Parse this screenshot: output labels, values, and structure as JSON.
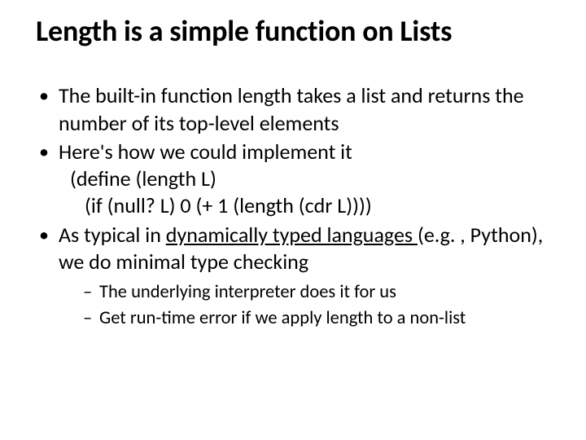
{
  "title": "Length is a simple function on Lists",
  "bullets": [
    {
      "text": "The built-in function length takes a list and returns the number of its top-level elements"
    },
    {
      "text": "Here's how we could implement it",
      "code1": "(define (length L)",
      "code2": "(if (null? L) 0 (+ 1 (length (cdr L))))"
    },
    {
      "prefix": "As typical in ",
      "link": "dynamically typed languages ",
      "suffix": "(e.g. , Python), we do minimal type checking",
      "sub": [
        "The underlying interpreter does it for us",
        "Get run-time error if we apply length to a non-list"
      ]
    }
  ]
}
